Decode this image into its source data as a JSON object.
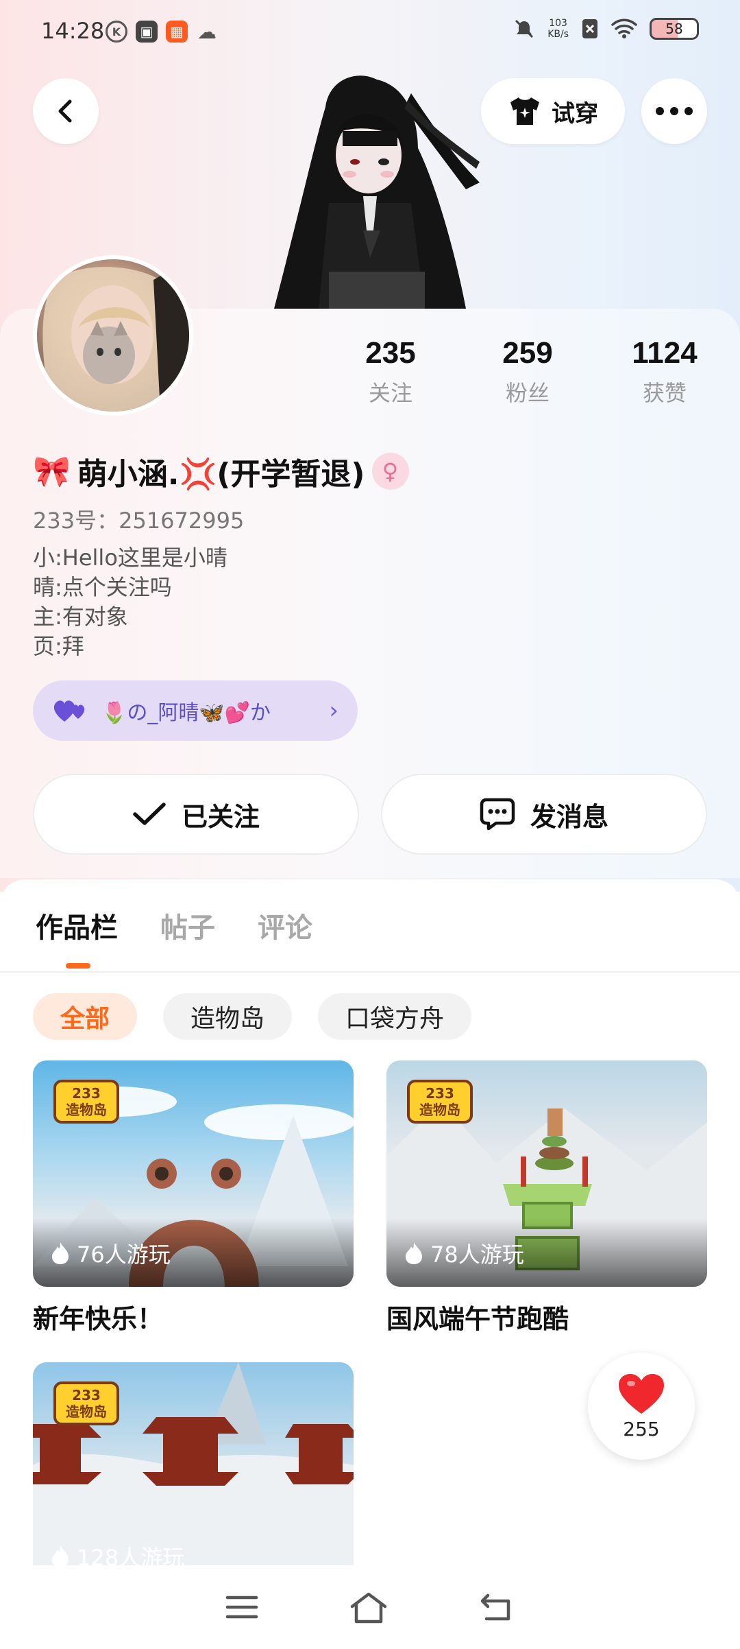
{
  "status_bar": {
    "time": "14:28",
    "net_speed_value": "103",
    "net_speed_unit": "KB/s",
    "battery": "58"
  },
  "header": {
    "try_on_label": "试穿"
  },
  "profile": {
    "stats": [
      {
        "value": "235",
        "label": "关注"
      },
      {
        "value": "259",
        "label": "粉丝"
      },
      {
        "value": "1124",
        "label": "获赞"
      }
    ],
    "name_prefix_emoji": "🎀",
    "name": "萌小涵.💢(开学暂退)",
    "gender_symbol": "♀",
    "uid": "233号：251672995",
    "bio": [
      "小:Hello这里是小晴",
      "晴:点个关注吗",
      "主:有对象",
      "页:拜"
    ],
    "cp_text": "🌷の_阿晴🦋💕か",
    "follow_label": "已关注",
    "message_label": "发消息"
  },
  "tabs": [
    {
      "label": "作品栏",
      "active": true
    },
    {
      "label": "帖子",
      "active": false
    },
    {
      "label": "评论",
      "active": false
    }
  ],
  "filters": [
    {
      "label": "全部",
      "active": true
    },
    {
      "label": "造物岛",
      "active": false
    },
    {
      "label": "口袋方舟",
      "active": false
    }
  ],
  "works": [
    {
      "title": "新年快乐！",
      "plays": "76人游玩"
    },
    {
      "title": "国风端午节跑酷",
      "plays": "78人游玩"
    },
    {
      "title": "",
      "plays": "128人游玩"
    }
  ],
  "logo_text": [
    "233",
    "造物岛"
  ],
  "like": {
    "count": "255",
    "color": "#f0282d"
  },
  "accent_color": "#ff6a1a"
}
